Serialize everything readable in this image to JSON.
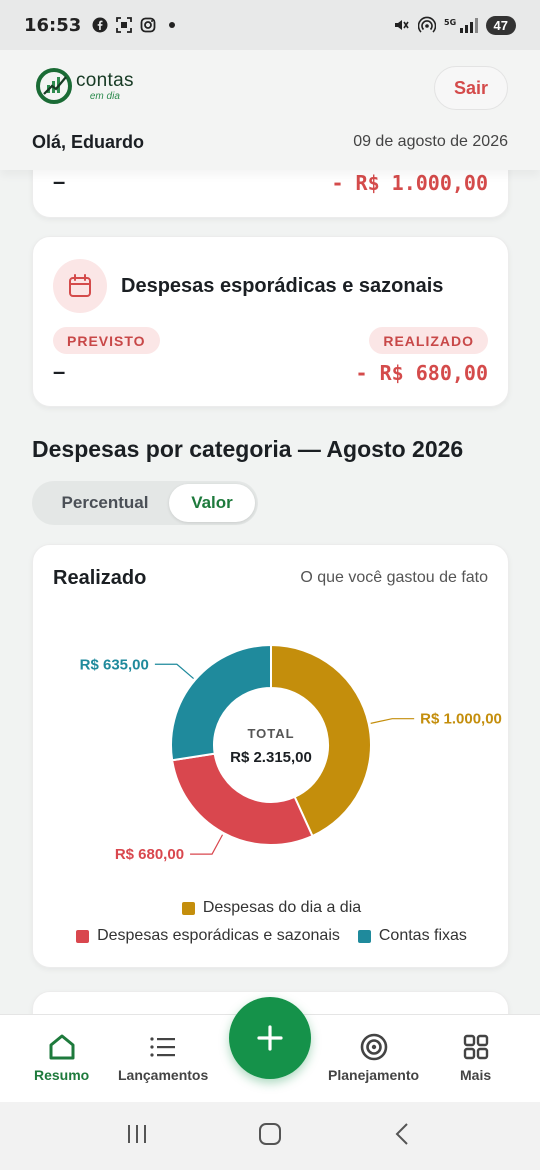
{
  "status_bar": {
    "time": "16:53",
    "battery": "47",
    "network": "5G"
  },
  "header": {
    "logo_main": "contas",
    "logo_sub": "em dia",
    "logout_label": "Sair",
    "greeting": "Olá, Eduardo",
    "date": "09 de agosto de 2026"
  },
  "card_top": {
    "previsto": "–",
    "realizado": "- R$ 1.000,00"
  },
  "card_sazonais": {
    "title": "Despesas esporádicas e sazonais",
    "previsto_label": "PREVISTO",
    "realizado_label": "REALIZADO",
    "previsto": "–",
    "realizado": "- R$ 680,00"
  },
  "section_title": "Despesas por categoria — Agosto 2026",
  "toggle": {
    "options": [
      "Percentual",
      "Valor"
    ],
    "selected": "Valor"
  },
  "chart_card": {
    "title": "Realizado",
    "subtitle": "O que você gastou de fato"
  },
  "chart_data": {
    "type": "pie",
    "donut": true,
    "center_label": "TOTAL",
    "center_value": "R$ 2.315,00",
    "total": 2315.0,
    "slices": [
      {
        "name": "Despesas do dia a dia",
        "value": 1000.0,
        "label": "R$ 1.000,00",
        "color": "#c48e0c"
      },
      {
        "name": "Despesas esporádicas e sazonais",
        "value": 680.0,
        "label": "R$ 680,00",
        "color": "#d9474e"
      },
      {
        "name": "Contas fixas",
        "value": 635.0,
        "label": "R$ 635,00",
        "color": "#1f8a9c"
      }
    ],
    "legend_position": "bottom"
  },
  "bottom_nav": {
    "items": [
      {
        "label": "Resumo",
        "icon": "home-icon",
        "active": true
      },
      {
        "label": "Lançamentos",
        "icon": "list-icon"
      },
      {
        "label": "Planejamento",
        "icon": "target-icon"
      },
      {
        "label": "Mais",
        "icon": "grid-icon"
      }
    ],
    "fab_icon": "plus-icon"
  },
  "colors": {
    "brand_green": "#15924a",
    "expense_red": "#d44b4b"
  }
}
